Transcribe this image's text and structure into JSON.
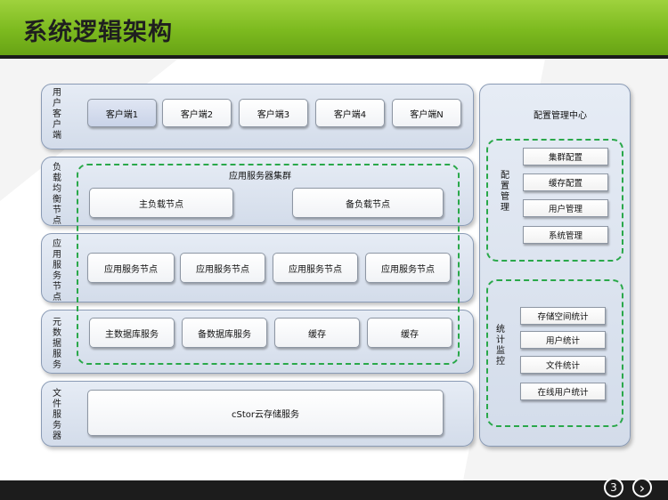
{
  "title": "系统逻辑架构",
  "rows": [
    {
      "label": "用户客户端"
    },
    {
      "label": "负载均衡节点"
    },
    {
      "label": "应用服务节点"
    },
    {
      "label": "元数据服务"
    },
    {
      "label": "文件服务器"
    }
  ],
  "clients": [
    "客户端1",
    "客户端2",
    "客户端3",
    "客户端4",
    "客户端N"
  ],
  "cluster_title": "应用服务器集群",
  "load_balance": [
    "主负载节点",
    "备负载节点"
  ],
  "app_nodes": [
    "应用服务节点",
    "应用服务节点",
    "应用服务节点",
    "应用服务节点"
  ],
  "metadata": [
    "主数据库服务",
    "备数据库服务",
    "缓存",
    "缓存"
  ],
  "storage": "cStor云存储服务",
  "config_center": {
    "title": "配置管理中心",
    "config_label": "配置管理",
    "config_items": [
      "集群配置",
      "缓存配置",
      "用户管理",
      "系统管理"
    ],
    "stats_label": "统计监控",
    "stats_items": [
      "存储空间统计",
      "用户统计",
      "文件统计",
      "在线用户统计"
    ]
  },
  "page_number": "3",
  "next_glyph": "›"
}
